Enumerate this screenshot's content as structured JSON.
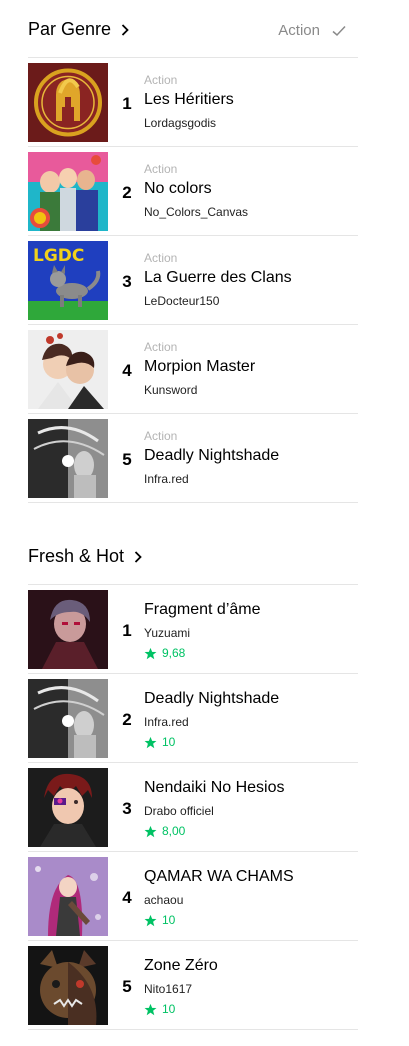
{
  "par_genre": {
    "title": "Par Genre",
    "filter": "Action",
    "items": [
      {
        "rank": "1",
        "genre": "Action",
        "title": "Les Héritiers",
        "author": "Lordagsgodis"
      },
      {
        "rank": "2",
        "genre": "Action",
        "title": "No colors",
        "author": "No_Colors_Canvas"
      },
      {
        "rank": "3",
        "genre": "Action",
        "title": "La Guerre des Clans",
        "author": "LeDocteur150",
        "cover_text": "LGDC"
      },
      {
        "rank": "4",
        "genre": "Action",
        "title": "Morpion Master",
        "author": "Kunsword"
      },
      {
        "rank": "5",
        "genre": "Action",
        "title": "Deadly Nightshade",
        "author": "Infra.red"
      }
    ]
  },
  "fresh_hot": {
    "title": "Fresh & Hot",
    "items": [
      {
        "rank": "1",
        "title": "Fragment d’âme",
        "author": "Yuzuami",
        "rating": "9,68"
      },
      {
        "rank": "2",
        "title": "Deadly Nightshade",
        "author": "Infra.red",
        "rating": "10"
      },
      {
        "rank": "3",
        "title": "Nendaiki No Hesios",
        "author": "Drabo officiel",
        "rating": "8,00"
      },
      {
        "rank": "4",
        "title": "QAMAR WA CHAMS",
        "author": "achaou",
        "rating": "10"
      },
      {
        "rank": "5",
        "title": "Zone Zéro",
        "author": "Nito1617",
        "rating": "10"
      }
    ]
  },
  "colors": {
    "accent_green": "#00c264",
    "muted": "#8a8a8a",
    "divider": "#e5e5e5"
  }
}
